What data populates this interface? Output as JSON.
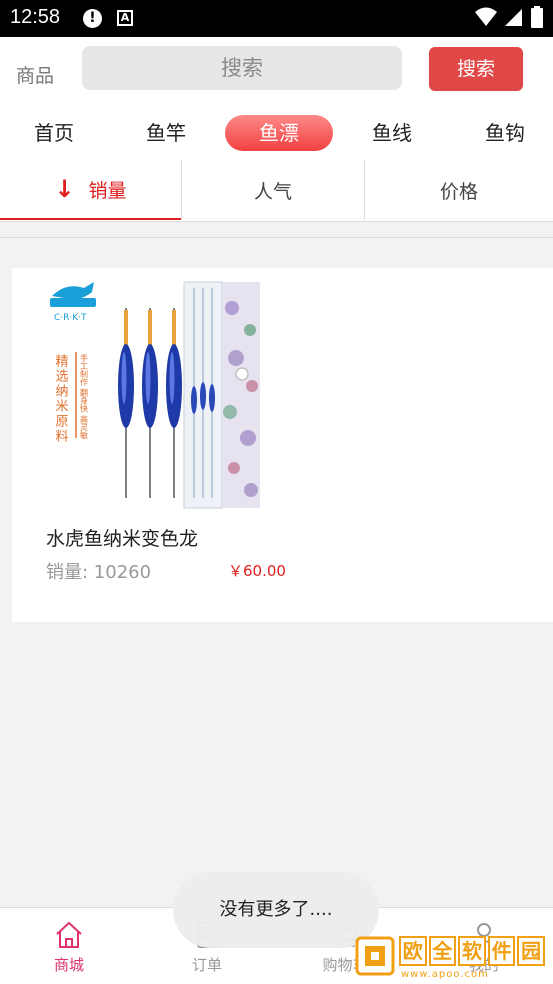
{
  "status_bar": {
    "time": "12:58",
    "alert_glyph": "!",
    "a_glyph": "A"
  },
  "header": {
    "label": "商品",
    "search_placeholder": "搜索",
    "search_button": "搜索"
  },
  "categories": [
    {
      "label": "首页",
      "active": false
    },
    {
      "label": "鱼竿",
      "active": false
    },
    {
      "label": "鱼漂",
      "active": true
    },
    {
      "label": "鱼线",
      "active": false
    },
    {
      "label": "鱼钩",
      "active": false
    }
  ],
  "sort": {
    "arrow": "↓",
    "items": [
      {
        "label": "销量",
        "active": true
      },
      {
        "label": "人气",
        "active": false
      },
      {
        "label": "价格",
        "active": false
      }
    ]
  },
  "product": {
    "name": "水虎鱼纳米变色龙",
    "sales": "销量: 10260",
    "price": "￥60.00",
    "image": {
      "brand": "C·R·K·T",
      "side_text": "精选纳米原料",
      "side_text2": "手工制作 翻身快 高灵敏"
    }
  },
  "toast": "没有更多了....",
  "bottom_nav": [
    {
      "label": "商城",
      "icon": "home-icon",
      "active": true
    },
    {
      "label": "订单",
      "icon": "order-icon",
      "active": false
    },
    {
      "label": "购物车",
      "icon": "cart-icon",
      "active": false
    },
    {
      "label": "我的",
      "icon": "person-icon",
      "active": false
    }
  ],
  "watermark": {
    "chars": [
      "欧",
      "全",
      "软",
      "件",
      "园"
    ],
    "url": "www.apoo.com"
  },
  "colors": {
    "accent": "#e01e1e",
    "search_button": "#e04848",
    "nav_active": "#e0336b",
    "watermark": "#f0a012"
  }
}
